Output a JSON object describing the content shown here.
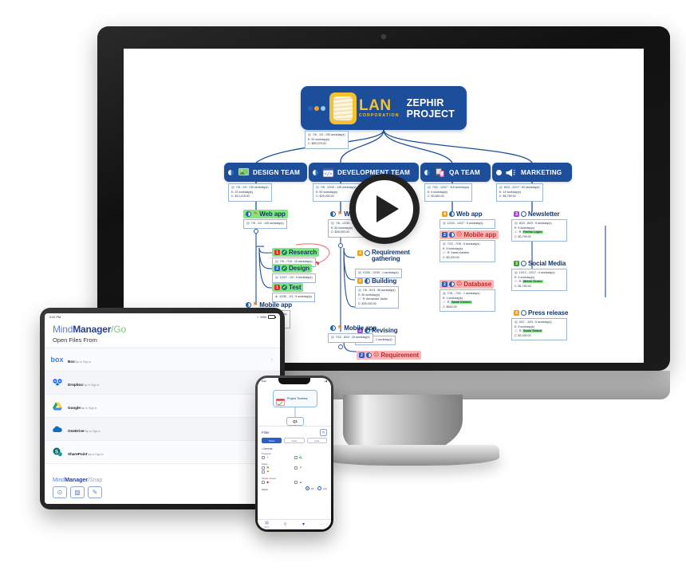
{
  "monitor": {
    "mindmap": {
      "root": {
        "title": "ZEPHIR PROJECT",
        "logo_name": "LAN",
        "logo_sub": "CORPORATION",
        "info": [
          "7/8 - 1/3 : 130 workday(s)",
          "E: 92 workday(s)",
          "C: $50,076.00"
        ]
      },
      "teams": [
        {
          "name": "DESIGN TEAM",
          "icon": "presentation-icon",
          "info": [
            "7/8 - 1/3 : 130 workday(s)",
            "E: 22 workday(s)",
            "C: $13,478.00"
          ],
          "branches": [
            {
              "label": "Web app",
              "style": "green",
              "flag": "flag-orange-icon",
              "progress": "prog-50",
              "info": [
                "7/8 - 1/3 : 130 workday(s)"
              ],
              "children": [
                {
                  "label": "Research",
                  "style": "green",
                  "priority": "1",
                  "priority_color": "#e03030",
                  "progress": "prog-100",
                  "info": [
                    "7/8 - 7/19 : 10 workday(s)"
                  ]
                },
                {
                  "label": "Design",
                  "style": "green",
                  "priority": "2",
                  "priority_color": "#2b5fc4",
                  "progress": "prog-100",
                  "info": [
                    "12/27 - 1/2 : 5 workday(s)"
                  ]
                },
                {
                  "label": "Test",
                  "style": "green",
                  "priority": "1",
                  "priority_color": "#e03030",
                  "progress": "prog-100",
                  "info": [
                    "12/30 - 1/3 : 5 workday(s)"
                  ]
                }
              ]
            },
            {
              "label": "Mobile app",
              "style": "plain",
              "flag": "flag-orange-icon",
              "progress": "prog-50",
              "info": [
                "8/23 - 12/27 : 91 workday(s)",
                "E: 22 workday(s)",
                "C: $13,478.00"
              ],
              "children": []
            }
          ]
        },
        {
          "name": "DEVELOPMENT TEAM",
          "icon": "code-window-icon",
          "info": [
            "7/8 - 12/30 : 126 workday(s)",
            "E: 50 workday(s)",
            "C: $26,000.00"
          ],
          "branches": [
            {
              "label": "Web app",
              "style": "plain",
              "flag": "flag-orange-icon",
              "progress": "prog-25",
              "info": [
                "7/8 - 12/30 : 126 workday(s)",
                "E: 50 workday(s)",
                "C: $26,000.00"
              ],
              "children": [
                {
                  "label": "Requirement gathering",
                  "style": "plain",
                  "priority": "4",
                  "priority_color": "#f0a020",
                  "progress": "prog-0",
                  "info": [
                    "12/30 - 12/30 : 1 workday(s)"
                  ]
                },
                {
                  "label": "Building",
                  "style": "plain",
                  "priority": "4",
                  "priority_color": "#f0a020",
                  "progress": "prog-50",
                  "info": [
                    "7/8 - 9/13 : 50 workday(s)",
                    "E: 50 workday(s)",
                    "R: Alexandre Jardin",
                    "C: $26,000.00"
                  ]
                },
                {
                  "label": "Revising",
                  "style": "plain",
                  "priority": "5",
                  "priority_color": "#a24bd0",
                  "progress": "prog-50",
                  "info": [
                    "9/6 - 9/6 : 1 workday(s)"
                  ]
                }
              ]
            },
            {
              "label": "Mobile app",
              "style": "plain",
              "flag": "flag-orange-icon",
              "progress": "prog-25",
              "info": [
                "7/22 - 8/23 : 25 workday(s)"
              ],
              "children": [
                {
                  "label": "Requirement",
                  "style": "pink",
                  "priority": "2",
                  "priority_color": "#2b5fc4",
                  "progress": "prog-50",
                  "info": []
                }
              ]
            }
          ]
        },
        {
          "name": "QA TEAM",
          "icon": "mobile-devices-icon",
          "info": [
            "7/22 - 12/27 : 115 workday(s)",
            "E: 6 workday(s)",
            "C: $3,840.00"
          ],
          "branches": [
            {
              "label": "Web app",
              "style": "plain",
              "priority": "4",
              "priority_color": "#f0a020",
              "progress": "prog-25",
              "info": [
                "12/23 - 12/27 : 5 workday(s)"
              ],
              "children": []
            },
            {
              "label": "Mobile app",
              "style": "pink",
              "priority": "2",
              "priority_color": "#2b5fc4",
              "progress": "prog-50",
              "alert": true,
              "info": [
                "7/22 - 7/26 : 5 workday(s)",
                "E: 5 workday(s)",
                "R: Sarah Karsten",
                "C: $3,200.00"
              ],
              "children": []
            },
            {
              "label": "Database",
              "style": "pink",
              "priority": "2",
              "priority_color": "#2b5fc4",
              "progress": "prog-50",
              "alert": true,
              "info": [
                "7/31 - 7/31 : 1 workday(s)",
                "E: 1 workday(s)",
                "R: Sarah Karsten",
                "C: $640.00"
              ],
              "highlight_resource": "Sarah Karsten",
              "children": []
            }
          ]
        },
        {
          "name": "MARKETING",
          "icon": "megaphone-icon",
          "info": [
            "8/23 - 12/17 : 83 workday(s)",
            "E: 14 workday(s)",
            "C: $6,750.00"
          ],
          "branches": [
            {
              "label": "Newsletter",
              "style": "plain",
              "priority": "3",
              "priority_color": "#a24bd0",
              "progress": "prog-0",
              "info": [
                "8/23 - 8/29 : 5 workday(s)",
                "E: 5 workday(s)",
                "R: Fatima Logan",
                "C: $2,799.00"
              ],
              "highlight_resource": "Fatima Logan",
              "children": []
            },
            {
              "label": "Social Media",
              "style": "plain",
              "priority": "3",
              "priority_color": "#3ba03b",
              "progress": "prog-0",
              "info": [
                "12/12 - 12/17 : 4 workday(s)",
                "E: 4 workday(s)",
                "R: Melvin Scurio",
                "C: $1,750.00"
              ],
              "highlight_resource": "Melvin Scurio",
              "children": []
            },
            {
              "label": "Press release",
              "style": "plain",
              "priority": "4",
              "priority_color": "#f0a020",
              "progress": "prog-0",
              "info": [
                "9/27 - 10/3 : 5 workday(s)",
                "E: 5 workday(s)",
                "R: Sonia Tonbor",
                "C: $2,200.00"
              ],
              "highlight_resource": "Sonia Tonbor",
              "children": []
            }
          ]
        }
      ]
    }
  },
  "play_button": {
    "label": "play-video"
  },
  "tablet": {
    "status": {
      "time": "2:02 PM",
      "carrier": "Wi-Fi",
      "battery": "93%"
    },
    "brand": {
      "part1": "Mind",
      "part2": "Manager",
      "slash": "/",
      "suffix": "Go"
    },
    "subtitle": "Open Files From",
    "items": [
      {
        "name": "Box",
        "sub": "Tap to Sign in",
        "icon": "box-icon",
        "color": "#3b7df6"
      },
      {
        "name": "Dropbox",
        "sub": "Tap to Sign in",
        "icon": "dropbox-icon",
        "color": "#0061ff"
      },
      {
        "name": "Google",
        "sub": "Tap to Sign in",
        "icon": "google-drive-icon",
        "color": "#34a853"
      },
      {
        "name": "OneDrive",
        "sub": "Tap to Sign in",
        "icon": "onedrive-icon",
        "color": "#0f6cbd"
      },
      {
        "name": "SharePoint",
        "sub": "Tap to Sign in",
        "icon": "sharepoint-icon",
        "color": "#036c70"
      }
    ],
    "footer": {
      "brand": {
        "part1": "Mind",
        "part2": "Manager",
        "slash": "/",
        "suffix": "Snap"
      },
      "buttons": [
        {
          "label": "camera-button",
          "glyph": "⊙"
        },
        {
          "label": "image-button",
          "glyph": "▨"
        },
        {
          "label": "pencil-button",
          "glyph": "✎"
        }
      ]
    }
  },
  "phone": {
    "status": {
      "time": "9:41",
      "battery": ""
    },
    "map": {
      "root_label": "Project Timeline",
      "child_label": "Q1"
    },
    "filter": {
      "title": "Filter",
      "segments": [
        {
          "label": "Show",
          "active": true
        },
        {
          "label": "Fade",
          "active": false
        },
        {
          "label": "Hide",
          "active": false
        }
      ],
      "close_label": "close-filter",
      "group_title": "General",
      "sections": [
        {
          "title": "Progress",
          "options": [
            {
              "glyph": "◔",
              "color": "#2b5fc4"
            },
            {
              "glyph": "✿",
              "color": "#2fa02f"
            }
          ]
        },
        {
          "title": "Flags",
          "options": [
            {
              "glyph": "⚑",
              "color": "#2fa02f"
            },
            {
              "glyph": "⚑",
              "color": "#f0a020"
            },
            {
              "glyph": "⚑",
              "color": "#e06a20"
            }
          ]
        },
        {
          "title": "Single Assets",
          "options": [
            {
              "glyph": "◆",
              "color": "#e03030"
            },
            {
              "glyph": "▲",
              "color": "#2fa02f"
            }
          ]
        }
      ],
      "match_label": "Match",
      "radios": [
        {
          "label": "All",
          "selected": true
        },
        {
          "label": "Any",
          "selected": false
        }
      ]
    },
    "tabs": [
      {
        "label": "Menu",
        "icon": "grid-icon",
        "active": false
      },
      {
        "label": "",
        "icon": "search-icon",
        "active": false
      },
      {
        "label": "",
        "icon": "filter-icon",
        "active": true
      },
      {
        "label": "",
        "icon": "more-icon",
        "active": false
      }
    ]
  }
}
